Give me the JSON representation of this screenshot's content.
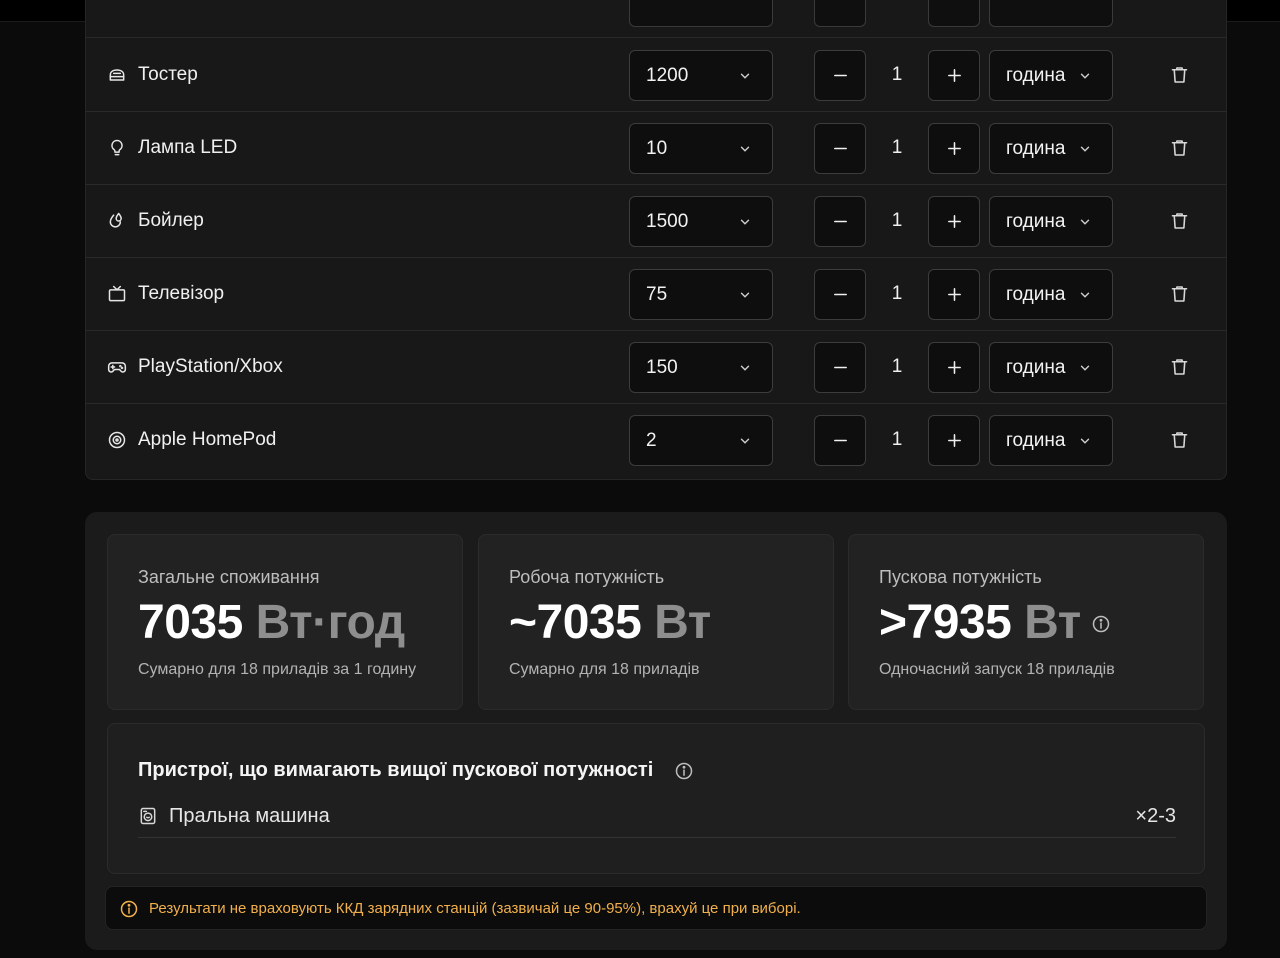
{
  "devices": [
    {
      "name": "Тостер",
      "icon": "toaster-icon",
      "watts": "1200",
      "qty": "1",
      "unit": "година"
    },
    {
      "name": "Лампа LED",
      "icon": "lightbulb-icon",
      "watts": "10",
      "qty": "1",
      "unit": "година"
    },
    {
      "name": "Бойлер",
      "icon": "water-heater-icon",
      "watts": "1500",
      "qty": "1",
      "unit": "година"
    },
    {
      "name": "Телевізор",
      "icon": "tv-icon",
      "watts": "75",
      "qty": "1",
      "unit": "година"
    },
    {
      "name": "PlayStation/Xbox",
      "icon": "gamepad-icon",
      "watts": "150",
      "qty": "1",
      "unit": "година"
    },
    {
      "name": "Apple HomePod",
      "icon": "speaker-icon",
      "watts": "2",
      "qty": "1",
      "unit": "година"
    }
  ],
  "summary": {
    "total": {
      "label": "Загальне споживання",
      "value": "7035",
      "unit": "Вт·год",
      "sub": "Сумарно для 18 приладів за 1 годину"
    },
    "running": {
      "label": "Робоча потужність",
      "value": "~7035",
      "unit": "Вт",
      "sub": "Сумарно для 18 приладів"
    },
    "startup": {
      "label": "Пускова потужність",
      "value": ">7935",
      "unit": "Вт",
      "sub": "Одночасний запуск 18 приладів"
    }
  },
  "surge": {
    "title": "Пристрої, що вимагають вищої пускової потужності",
    "items": [
      {
        "name": "Пральна машина",
        "icon": "washing-machine-icon",
        "multiplier": "×2-3"
      }
    ]
  },
  "notice": {
    "text": "Результати не враховують ККД зарядних станцій (зазвичай це 90-95%), врахуй це при виборі.",
    "color": "#f1b04c"
  }
}
